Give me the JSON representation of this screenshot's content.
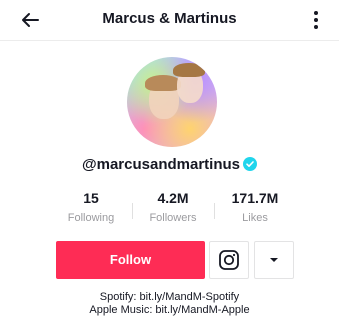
{
  "header": {
    "title": "Marcus & Martinus",
    "back_icon": "arrow-left-icon",
    "more_icon": "vertical-dots-icon"
  },
  "profile": {
    "username": "@marcusandmartinus",
    "verified_icon": "verified-badge-icon",
    "verified_color": "#20d5ec"
  },
  "stats": [
    {
      "value": "15",
      "label": "Following"
    },
    {
      "value": "4.2M",
      "label": "Followers"
    },
    {
      "value": "171.7M",
      "label": "Likes"
    }
  ],
  "actions": {
    "follow_label": "Follow",
    "follow_color": "#fe2c55",
    "instagram_icon": "instagram-icon",
    "dropdown_icon": "caret-down-icon"
  },
  "bio": {
    "line1": "Spotify: bit.ly/MandM-Spotify",
    "line2": "Apple Music: bit.ly/MandM-Apple"
  }
}
